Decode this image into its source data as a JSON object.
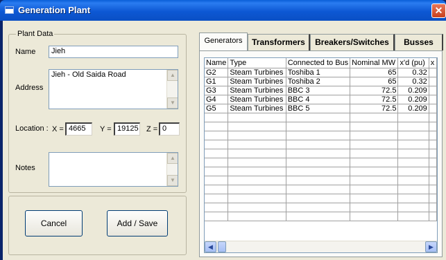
{
  "window": {
    "title": "Generation Plant",
    "close_glyph": "✕"
  },
  "plant_data": {
    "group_label": "Plant Data",
    "name_label": "Name",
    "name_value": "Jieh",
    "address_label": "Address",
    "address_value": "Jieh - Old Saida Road",
    "location_label": "Location :",
    "x_label": "X =",
    "x_value": "4665",
    "y_label": "Y =",
    "y_value": "19125",
    "z_label": "Z =",
    "z_value": "0",
    "notes_label": "Notes",
    "notes_value": ""
  },
  "buttons": {
    "cancel": "Cancel",
    "add_save": "Add / Save"
  },
  "tabs": [
    {
      "label": "Generators",
      "active": true
    },
    {
      "label": "Transformers",
      "active": false
    },
    {
      "label": "Breakers/Switches",
      "active": false
    },
    {
      "label": "Busses",
      "active": false
    }
  ],
  "grid": {
    "columns": [
      "Name",
      "Type",
      "Connected to Bus",
      "Nominal MW",
      "x'd (pu)",
      "x"
    ],
    "rows": [
      [
        "G2",
        "Steam Turbines",
        "Toshiba 1",
        "65",
        "0.32"
      ],
      [
        "G1",
        "Steam Turbines",
        "Toshiba 2",
        "65",
        "0.32"
      ],
      [
        "G3",
        "Steam Turbines",
        "BBC 3",
        "72.5",
        "0.209"
      ],
      [
        "G4",
        "Steam Turbines",
        "BBC 4",
        "72.5",
        "0.209"
      ],
      [
        "G5",
        "Steam Turbines",
        "BBC 5",
        "72.5",
        "0.209"
      ]
    ]
  },
  "icons": {
    "scroll_up": "▲",
    "scroll_down": "▼",
    "scroll_left": "◀",
    "scroll_right": "▶"
  }
}
